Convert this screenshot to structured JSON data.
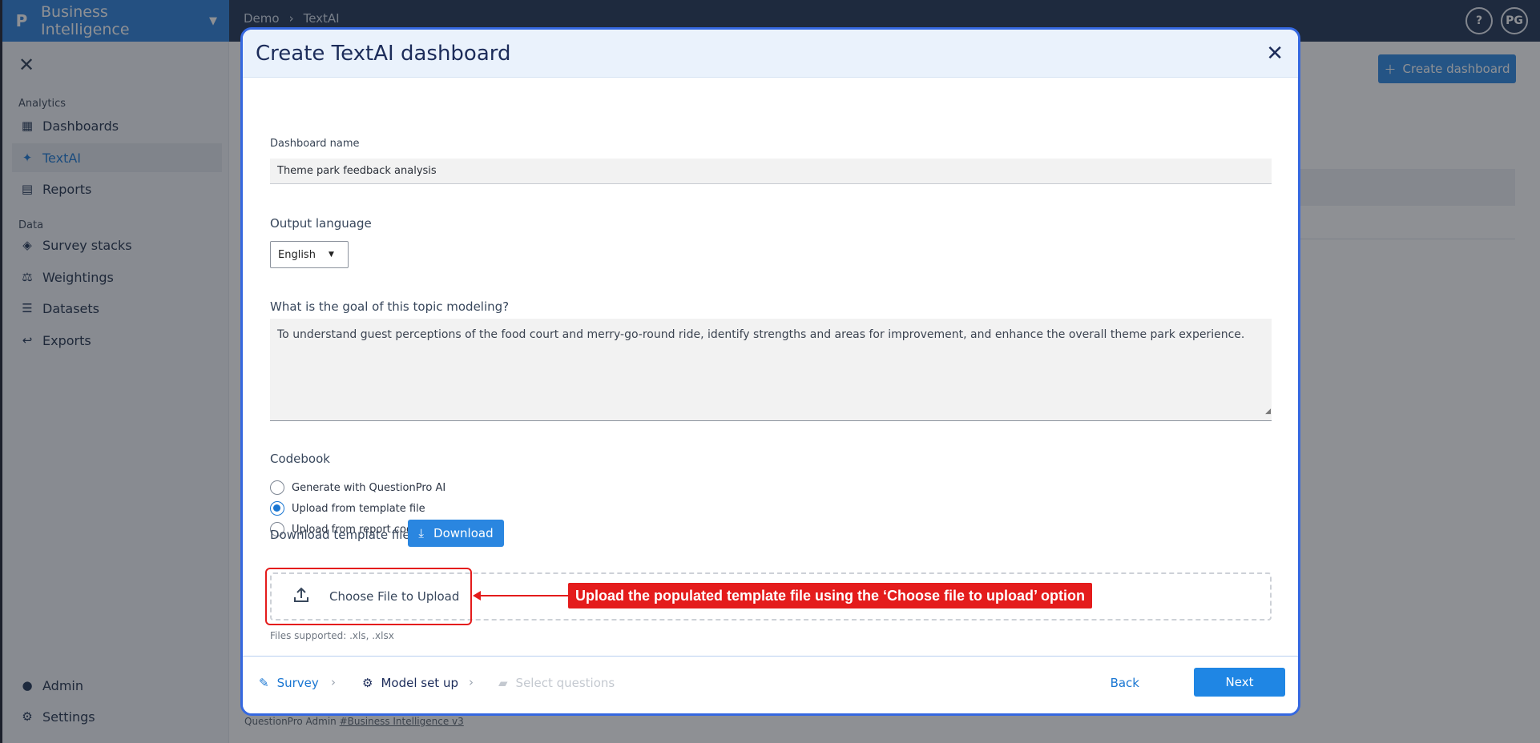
{
  "app": {
    "brand": "Business Intelligence",
    "breadcrumb": [
      "Demo",
      "TextAI"
    ],
    "help_label": "?",
    "avatar_initials": "PG",
    "create_dashboard_label": "Create dashboard",
    "footer_prefix": "QuestionPro Admin",
    "footer_link": "#Business Intelligence v3"
  },
  "sidebar": {
    "analytics_heading": "Analytics",
    "data_heading": "Data",
    "items": [
      {
        "label": "Dashboards",
        "icon": "dashboard-icon"
      },
      {
        "label": "TextAI",
        "icon": "sparkle-icon"
      },
      {
        "label": "Reports",
        "icon": "report-icon"
      },
      {
        "label": "Survey stacks",
        "icon": "survey-stack-icon"
      },
      {
        "label": "Weightings",
        "icon": "scale-icon"
      },
      {
        "label": "Datasets",
        "icon": "list-icon"
      },
      {
        "label": "Exports",
        "icon": "reply-icon"
      },
      {
        "label": "Admin",
        "icon": "user-icon"
      },
      {
        "label": "Settings",
        "icon": "gear-icon"
      }
    ]
  },
  "modal": {
    "title": "Create TextAI dashboard",
    "dashboard_name_label": "Dashboard name",
    "dashboard_name_value": "Theme park feedback analysis",
    "output_language_label": "Output language",
    "output_language_value": "English",
    "goal_label": "What is the goal of this topic modeling?",
    "goal_value": "To understand guest perceptions of the food court and merry-go-round ride, identify strengths and areas for improvement, and enhance the overall theme park experience.",
    "codebook_label": "Codebook",
    "codebook_options": [
      {
        "label": "Generate with QuestionPro AI",
        "selected": false
      },
      {
        "label": "Upload from template file",
        "selected": true
      },
      {
        "label": "Upload from report codebook",
        "selected": false
      }
    ],
    "download_template_label": "Download template file",
    "download_button": "Download",
    "upload_button": "Choose File to Upload",
    "files_supported": "Files supported: .xls, .xlsx",
    "annotation": "Upload the populated template file using the ‘Choose file to upload’ option",
    "steps": [
      {
        "label": "Survey",
        "state": "done"
      },
      {
        "label": "Model set up",
        "state": "current"
      },
      {
        "label": "Select questions",
        "state": "disabled"
      }
    ],
    "back_button": "Back",
    "next_button": "Next"
  },
  "colors": {
    "brand_blue": "#2b7fd8",
    "topbar": "#1f3352",
    "accent": "#1976d2",
    "modal_border": "#3568e0",
    "annotation_red": "#e41c1c"
  }
}
